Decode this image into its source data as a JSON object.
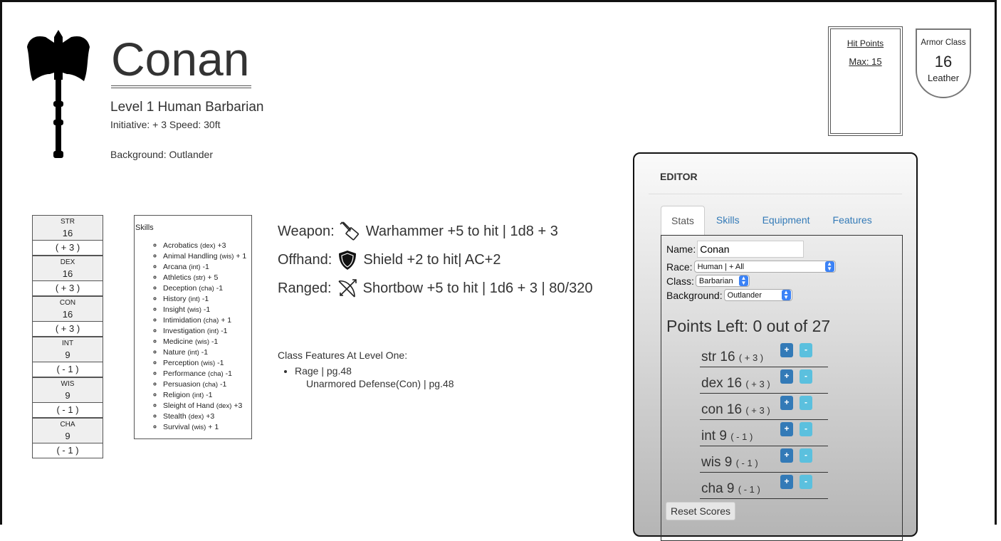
{
  "character": {
    "name": "Conan",
    "subtitle": "Level 1 Human Barbarian",
    "initiative_speed": "Initiative: + 3 Speed: 30ft",
    "background": "Background: Outlander"
  },
  "hit_points": {
    "label": "Hit Points",
    "max": "Max: 15"
  },
  "armor_class": {
    "label": "Armor Class",
    "value": "16",
    "armor": "Leather"
  },
  "stats": [
    {
      "name": "STR",
      "value": "16",
      "mod": "( + 3 )"
    },
    {
      "name": "DEX",
      "value": "16",
      "mod": "( + 3 )"
    },
    {
      "name": "CON",
      "value": "16",
      "mod": "( + 3 )"
    },
    {
      "name": "INT",
      "value": "9",
      "mod": "( - 1 )"
    },
    {
      "name": "WIS",
      "value": "9",
      "mod": "( - 1 )"
    },
    {
      "name": "CHA",
      "value": "9",
      "mod": "( - 1 )"
    }
  ],
  "skills": {
    "title": "Skills",
    "items": [
      {
        "name": "Acrobatics",
        "ability": "(dex)",
        "mod": "+3"
      },
      {
        "name": "Animal Handling",
        "ability": "(wis)",
        "mod": "+ 1"
      },
      {
        "name": "Arcana",
        "ability": "(int)",
        "mod": "-1"
      },
      {
        "name": "Athletics",
        "ability": "(str)",
        "mod": "+ 5"
      },
      {
        "name": "Deception",
        "ability": "(cha)",
        "mod": "-1"
      },
      {
        "name": "History",
        "ability": "(int)",
        "mod": "-1"
      },
      {
        "name": "Insight",
        "ability": "(wis)",
        "mod": "-1"
      },
      {
        "name": "Intimidation",
        "ability": "(cha)",
        "mod": "+ 1"
      },
      {
        "name": "Investigation",
        "ability": "(int)",
        "mod": "-1"
      },
      {
        "name": "Medicine",
        "ability": "(wis)",
        "mod": "-1"
      },
      {
        "name": "Nature",
        "ability": "(int)",
        "mod": "-1"
      },
      {
        "name": "Perception",
        "ability": "(wis)",
        "mod": "-1"
      },
      {
        "name": "Performance",
        "ability": "(cha)",
        "mod": "-1"
      },
      {
        "name": "Persuasion",
        "ability": "(cha)",
        "mod": "-1"
      },
      {
        "name": "Religion",
        "ability": "(int)",
        "mod": "-1"
      },
      {
        "name": "Sleight of Hand",
        "ability": "(dex)",
        "mod": "+3"
      },
      {
        "name": "Stealth",
        "ability": "(dex)",
        "mod": "+3"
      },
      {
        "name": "Survival",
        "ability": "(wis)",
        "mod": "+ 1"
      }
    ]
  },
  "weapons": {
    "weapon_label": "Weapon:",
    "weapon_text": "Warhammer +5 to hit | 1d8 + 3",
    "weapon_icon": "warhammer-icon",
    "offhand_label": "Offhand:",
    "offhand_text": "Shield +2 to hit| AC+2",
    "offhand_icon": "shield-icon",
    "ranged_label": "Ranged:",
    "ranged_text": "Shortbow +5 to hit | 1d6 + 3 | 80/320",
    "ranged_icon": "bow-icon"
  },
  "class_features": {
    "title": "Class Features At Level One:",
    "rage": "Rage",
    "rage_page": "| pg.48",
    "unarmored": "Unarmored Defense(Con) | pg.48"
  },
  "editor": {
    "title": "EDITOR",
    "tabs": [
      "Stats",
      "Skills",
      "Equipment",
      "Features"
    ],
    "name_label": "Name:",
    "name_value": "Conan",
    "race_label": "Race:",
    "race_value": "Human | + All",
    "class_label": "Class:",
    "class_value": "Barbarian",
    "background_label": "Background:",
    "background_value": "Outlander",
    "points_left": "Points Left: 0 out of 27",
    "abilities": [
      {
        "abbr": "str",
        "value": "16",
        "mod": "( + 3 )"
      },
      {
        "abbr": "dex",
        "value": "16",
        "mod": "( + 3 )"
      },
      {
        "abbr": "con",
        "value": "16",
        "mod": "( + 3 )"
      },
      {
        "abbr": "int",
        "value": "9",
        "mod": "( - 1 )"
      },
      {
        "abbr": "wis",
        "value": "9",
        "mod": "( - 1 )"
      },
      {
        "abbr": "cha",
        "value": "9",
        "mod": "( - 1 )"
      }
    ],
    "plus_label": "+",
    "minus_label": "-",
    "reset_label": "Reset Scores"
  },
  "colors": {
    "primary_button": "#337ab7",
    "info_button": "#5bc0de",
    "link": "#337ab7"
  }
}
